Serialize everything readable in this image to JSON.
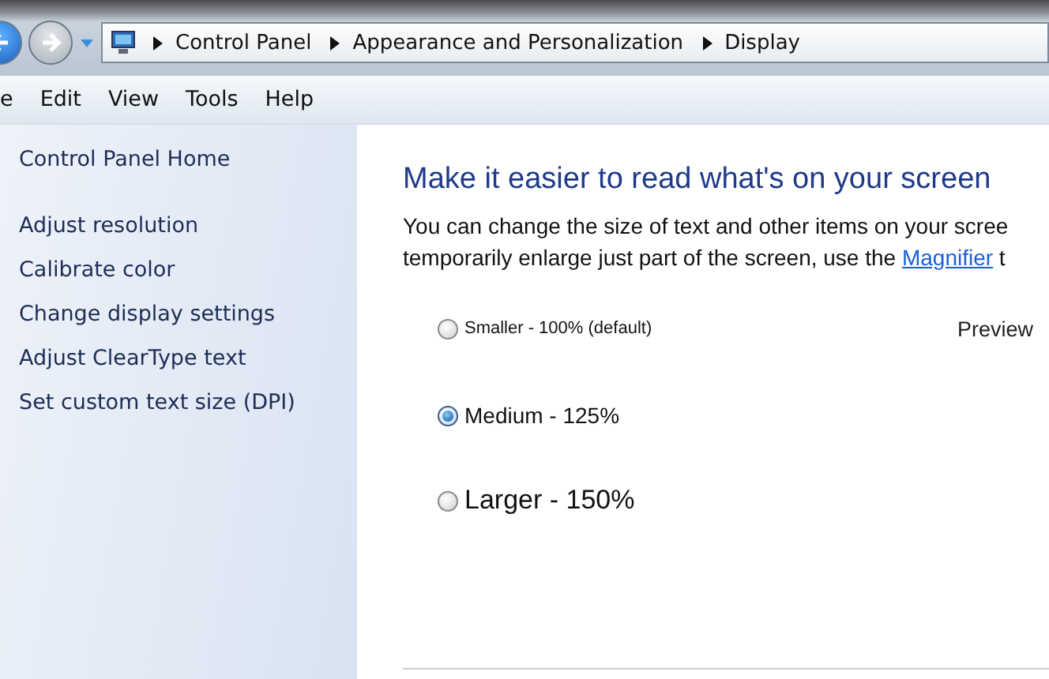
{
  "breadcrumb": [
    "Control Panel",
    "Appearance and Personalization",
    "Display"
  ],
  "menu": [
    "e",
    "Edit",
    "View",
    "Tools",
    "Help"
  ],
  "sidebar": {
    "home": "Control Panel Home",
    "items": [
      "Adjust resolution",
      "Calibrate color",
      "Change display settings",
      "Adjust ClearType text",
      "Set custom text size (DPI)"
    ]
  },
  "content": {
    "title": "Make it easier to read what's on your screen",
    "description": {
      "line_1": "You can change the size of text and other items on your scree",
      "line_2_before": "temporarily enlarge just part of the screen, use the ",
      "link": "Magnifier",
      "line_2_after": " t"
    },
    "preview": "Preview",
    "options": [
      {
        "label": "Smaller - 100% (default)",
        "kind": "small",
        "selected": false
      },
      {
        "label": "Medium - 125%",
        "kind": "medium",
        "selected": true
      },
      {
        "label": "Larger - 150%",
        "kind": "large",
        "selected": false
      }
    ]
  }
}
